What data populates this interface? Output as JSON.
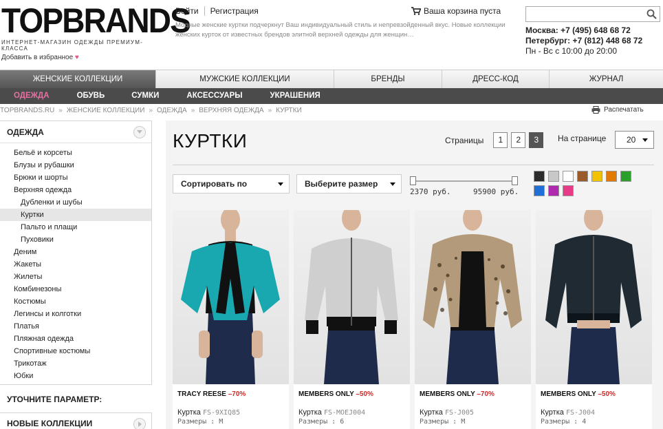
{
  "header": {
    "logo": "TOPBRANDS",
    "tagline": "ИНТЕРНЕТ-МАГАЗИН ОДЕЖДЫ ПРЕМИУМ-КЛАССА",
    "favorites": "Добавить в избранное",
    "links": [
      "Войти",
      "Регистрация"
    ],
    "description": "Модные женские куртки подчеркнут Ваш индивидуальный стиль и непревзойденный вкус. Новые коллекции женских курток от известных брендов элитной верхней одежды для женщин…",
    "cart": "Ваша корзина пуста",
    "search_placeholder": "",
    "phone_moscow": "Москва: +7 (495) 648 68 72",
    "phone_spb": "Петербург: +7 (812) 448 68 72",
    "hours": "Пн - Вс с 10:00 до 20:00"
  },
  "mainnav": [
    "ЖЕНСКИЕ КОЛЛЕКЦИИ",
    "МУЖСКИЕ КОЛЛЕКЦИИ",
    "БРЕНДЫ",
    "ДРЕСС-КОД",
    "ЖУРНАЛ"
  ],
  "subnav": [
    "ОДЕЖДА",
    "ОБУВЬ",
    "СУМКИ",
    "АКСЕССУАРЫ",
    "УКРАШЕНИЯ"
  ],
  "breadcrumbs": [
    "TOPBRANDS.RU",
    "ЖЕНСКИЕ КОЛЛЕКЦИИ",
    "ОДЕЖДА",
    "ВЕРХНЯЯ ОДЕЖДА",
    "КУРТКИ"
  ],
  "print": "Распечатать",
  "sidebar": {
    "title": "ОДЕЖДА",
    "items": [
      "Бельё и корсеты",
      "Блузы и рубашки",
      "Брюки и шорты",
      "Верхняя одежда",
      "Дубленки и шубы",
      "Куртки",
      "Пальто и плащи",
      "Пуховики",
      "Деним",
      "Жакеты",
      "Жилеты",
      "Комбинезоны",
      "Костюмы",
      "Легинсы и колготки",
      "Платья",
      "Пляжная одежда",
      "Спортивные костюмы",
      "Трикотаж",
      "Юбки"
    ],
    "refine": "УТОЧНИТЕ ПАРАМЕТР:",
    "new_collections": "НОВЫЕ КОЛЛЕКЦИИ"
  },
  "content": {
    "title": "КУРТКИ",
    "pages_label": "Страницы",
    "pages": [
      "1",
      "2",
      "3"
    ],
    "current_page": "3",
    "per_page_label": "На странице",
    "per_page": "20",
    "sort": "Сортировать по",
    "size": "Выберите размер",
    "price_min": "2370 руб.",
    "price_max": "95900 руб.",
    "colors": [
      "#2b2b2b",
      "#c8c8c8",
      "#ffffff",
      "#9a5a2a",
      "#f2c200",
      "#e07a00",
      "#2aa02a",
      "#1f6fd6",
      "#b02ab0",
      "#e83a86"
    ]
  },
  "products": [
    {
      "brand": "TRACY REESE",
      "discount": "–70%",
      "name": "Куртка",
      "code": "FS-9XIQ85",
      "size": "Размеры : М",
      "color": "#1aa8b0"
    },
    {
      "brand": "MEMBERS ONLY",
      "discount": "–50%",
      "name": "Куртка",
      "code": "FS-MOEJ004",
      "size": "Размеры : 6",
      "color": "#cfcfcf"
    },
    {
      "brand": "MEMBERS ONLY",
      "discount": "–70%",
      "name": "Куртка",
      "code": "FS-J005",
      "size": "Размеры : М",
      "color": "#b39a7a"
    },
    {
      "brand": "MEMBERS ONLY",
      "discount": "–50%",
      "name": "Куртка",
      "code": "FS-J004",
      "size": "Размеры : 4",
      "color": "#1f2a33"
    }
  ]
}
